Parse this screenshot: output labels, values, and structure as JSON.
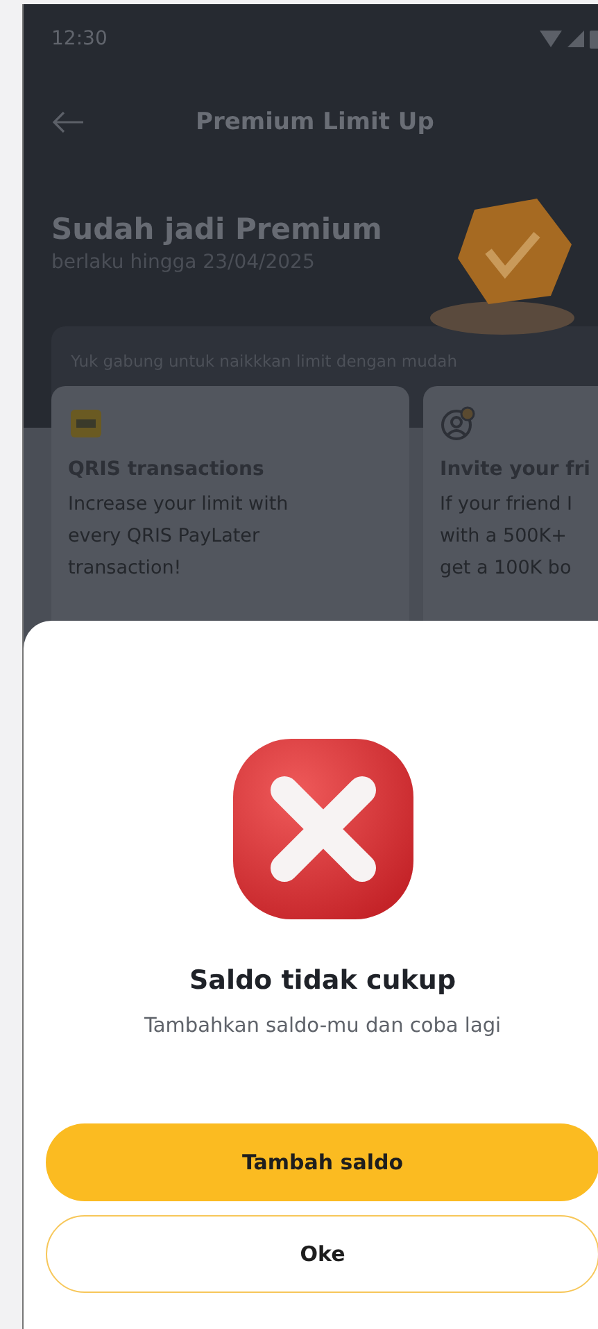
{
  "status_bar": {
    "time": "12:30"
  },
  "header": {
    "title": "Premium Limit Up"
  },
  "hero": {
    "title": "Sudah jadi Premium",
    "subtitle": "berlaku hingga 23/04/2025"
  },
  "banner": {
    "text": "Yuk gabung untuk naikkkan limit dengan mudah"
  },
  "cards": [
    {
      "kind": "qris",
      "title": "QRIS transactions",
      "lines": [
        "Increase your limit with",
        "every QRIS PayLater",
        "transaction!"
      ]
    },
    {
      "kind": "invite",
      "title": "Invite your fri",
      "lines": [
        "If your friend I",
        "with a 500K+",
        "get a 100K bo"
      ]
    }
  ],
  "dialog": {
    "title": "Saldo tidak cukup",
    "message": "Tambahkan saldo-mu dan coba lagi",
    "buttons": [
      {
        "kind": "primary",
        "label": "Tambah saldo"
      },
      {
        "kind": "outline",
        "label": "Oke"
      }
    ]
  }
}
